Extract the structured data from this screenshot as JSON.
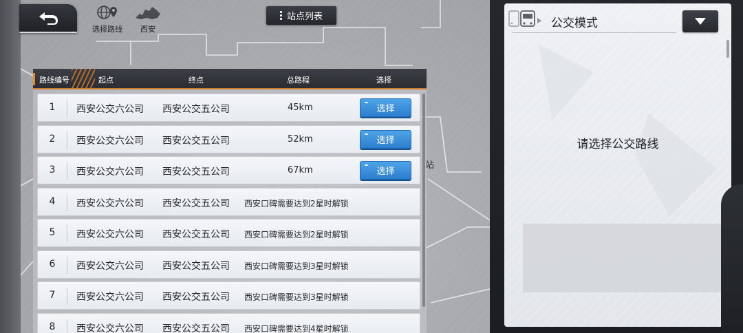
{
  "top_bar": {
    "select_route_label": "选择路线",
    "city_label": "西安",
    "station_list_label": "站点列表"
  },
  "map": {
    "partial_label": "站"
  },
  "table": {
    "headers": {
      "route_no": "路线编号",
      "start": "起点",
      "end": "终点",
      "distance": "总路程",
      "select": "选择"
    },
    "select_button_label": "选择",
    "rows": [
      {
        "num": "1",
        "start": "西安公交六公司",
        "end": "西安公交五公司",
        "distance": "45km",
        "locked": false
      },
      {
        "num": "2",
        "start": "西安公交六公司",
        "end": "西安公交五公司",
        "distance": "52km",
        "locked": false
      },
      {
        "num": "3",
        "start": "西安公交六公司",
        "end": "西安公交五公司",
        "distance": "67km",
        "locked": false
      },
      {
        "num": "4",
        "start": "西安公交六公司",
        "end": "西安公交五公司",
        "lock_text": "西安口碑需要达到2星时解锁",
        "locked": true
      },
      {
        "num": "5",
        "start": "西安公交六公司",
        "end": "西安公交五公司",
        "lock_text": "西安口碑需要达到2星时解锁",
        "locked": true
      },
      {
        "num": "6",
        "start": "西安公交六公司",
        "end": "西安公交五公司",
        "lock_text": "西安口碑需要达到3星时解锁",
        "locked": true
      },
      {
        "num": "7",
        "start": "西安公交六公司",
        "end": "西安公交五公司",
        "lock_text": "西安口碑需要达到3星时解锁",
        "locked": true
      },
      {
        "num": "8",
        "start": "西安公交六公司",
        "end": "西安公交五公司",
        "lock_text": "西安口碑需要达到4星时解锁",
        "locked": true
      }
    ]
  },
  "right_panel": {
    "mode_title": "公交模式",
    "prompt": "请选择公交路线"
  },
  "colors": {
    "accent_orange": "#d07a2c",
    "select_blue": "#2c7fcf",
    "dark_button": "#26282d"
  },
  "icons": {
    "back": "back-arrow-icon",
    "route": "globe-pin-icon",
    "city": "city-map-icon",
    "list": "list-dots-icon",
    "bus": "bus-icon",
    "dropdown": "triangle-down-icon"
  }
}
